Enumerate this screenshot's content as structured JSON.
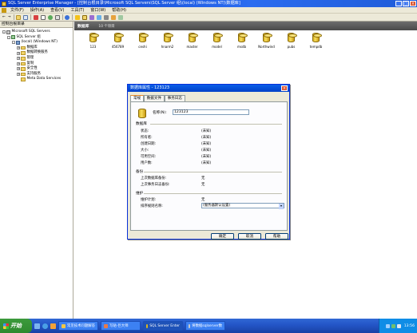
{
  "window": {
    "title": "SQL Server Enterprise Manager - [控制台根目录\\Microsoft SQL Servers\\SQL Server 组\\(local) (Windows NT)\\数据库]",
    "minimize": "_",
    "maximize": "□",
    "close": "×"
  },
  "menu": {
    "items": [
      "文件(F)",
      "操作(A)",
      "查看(V)",
      "工具(T)",
      "窗口(W)",
      "帮助(H)"
    ]
  },
  "toolbar": {
    "back_label": "←",
    "forward_label": "→"
  },
  "tree": {
    "header": "控制台根目录",
    "rows": [
      {
        "label": "Microsoft SQL Servers",
        "indent": 0,
        "exp": "-",
        "icon": "console"
      },
      {
        "label": "SQL Server 组",
        "indent": 1,
        "exp": "-",
        "icon": "group"
      },
      {
        "label": "(local) (Windows NT)",
        "indent": 2,
        "exp": "-",
        "icon": "server"
      },
      {
        "label": "数据库",
        "indent": 3,
        "exp": "+",
        "icon": "folder"
      },
      {
        "label": "数据转换服务",
        "indent": 3,
        "exp": "+",
        "icon": "folder"
      },
      {
        "label": "管理",
        "indent": 3,
        "exp": "+",
        "icon": "folder"
      },
      {
        "label": "复制",
        "indent": 3,
        "exp": "+",
        "icon": "folder"
      },
      {
        "label": "安全性",
        "indent": 3,
        "exp": "+",
        "icon": "folder"
      },
      {
        "label": "支持服务",
        "indent": 3,
        "exp": "+",
        "icon": "folder"
      },
      {
        "label": "Meta Data Services",
        "indent": 3,
        "exp": "",
        "icon": "folder"
      }
    ]
  },
  "content": {
    "header_title": "数据库",
    "header_count": "10 个项目",
    "databases": [
      "123",
      "456789",
      "ceshi",
      "hnarm2",
      "master",
      "model",
      "msdb",
      "Northwind",
      "pubs",
      "tempdb"
    ]
  },
  "dialog": {
    "title": "数据库属性 - 123123",
    "close": "×",
    "tabs": [
      "常规",
      "数据文件",
      "事务日志"
    ],
    "name_label": "名称(N):",
    "name_value": "123123",
    "sections": {
      "database": "数据库",
      "backup": "备份",
      "maintenance": "维护"
    },
    "db_props": [
      {
        "label": "状态:",
        "value": "(未知)"
      },
      {
        "label": "所有者:",
        "value": "(未知)"
      },
      {
        "label": "创建日期:",
        "value": "(未知)"
      },
      {
        "label": "大小:",
        "value": "(未知)"
      },
      {
        "label": "可用空间:",
        "value": "(未知)"
      },
      {
        "label": "用户数:",
        "value": "(未知)"
      }
    ],
    "backup_props": [
      {
        "label": "上次数据库备份:",
        "value": "无"
      },
      {
        "label": "上次事务日志备份:",
        "value": "无"
      }
    ],
    "maint_props": [
      {
        "label": "维护计划:",
        "value": "无"
      }
    ],
    "collation_label": "排序规则名称:",
    "collation_value": "(服务器默认设置)",
    "buttons": {
      "ok": "确定",
      "cancel": "取消",
      "help": "帮助"
    }
  },
  "taskbar": {
    "start": "开始",
    "items": [
      {
        "label": "常见技术问题解答",
        "active": false
      },
      {
        "label": "写贴-巨大师",
        "active": false
      },
      {
        "label": "SQL Server Enter",
        "active": true
      },
      {
        "label": "将数据sqlserver数",
        "active": false
      }
    ],
    "clock": "13:56"
  }
}
